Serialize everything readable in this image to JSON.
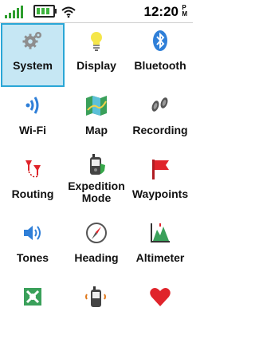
{
  "status_bar": {
    "time": "12:20",
    "ampm": "P\nM",
    "icons": [
      "signal-bars-icon",
      "battery-icon",
      "wifi-icon"
    ]
  },
  "menu": {
    "items": [
      {
        "label": "System",
        "icon": "gear-icon",
        "selected": true
      },
      {
        "label": "Display",
        "icon": "lightbulb-icon"
      },
      {
        "label": "Bluetooth",
        "icon": "bluetooth-icon"
      },
      {
        "label": "Wi-Fi",
        "icon": "wifi-signal-icon"
      },
      {
        "label": "Map",
        "icon": "map-icon"
      },
      {
        "label": "Recording",
        "icon": "footprints-icon"
      },
      {
        "label": "Routing",
        "icon": "route-pins-icon"
      },
      {
        "label": "Expedition Mode",
        "icon": "expedition-device-icon"
      },
      {
        "label": "Waypoints",
        "icon": "flag-icon"
      },
      {
        "label": "Tones",
        "icon": "speaker-icon"
      },
      {
        "label": "Heading",
        "icon": "compass-icon"
      },
      {
        "label": "Altimeter",
        "icon": "altimeter-icon"
      },
      {
        "label": "",
        "icon": "geocache-icon"
      },
      {
        "label": "",
        "icon": "handheld-device-icon"
      },
      {
        "label": "",
        "icon": "heart-icon"
      }
    ]
  },
  "colors": {
    "selection_bg": "#c6e7f4",
    "selection_border": "#2aa6d6",
    "battery_green": "#3db33d",
    "accent_red": "#e0242b"
  }
}
